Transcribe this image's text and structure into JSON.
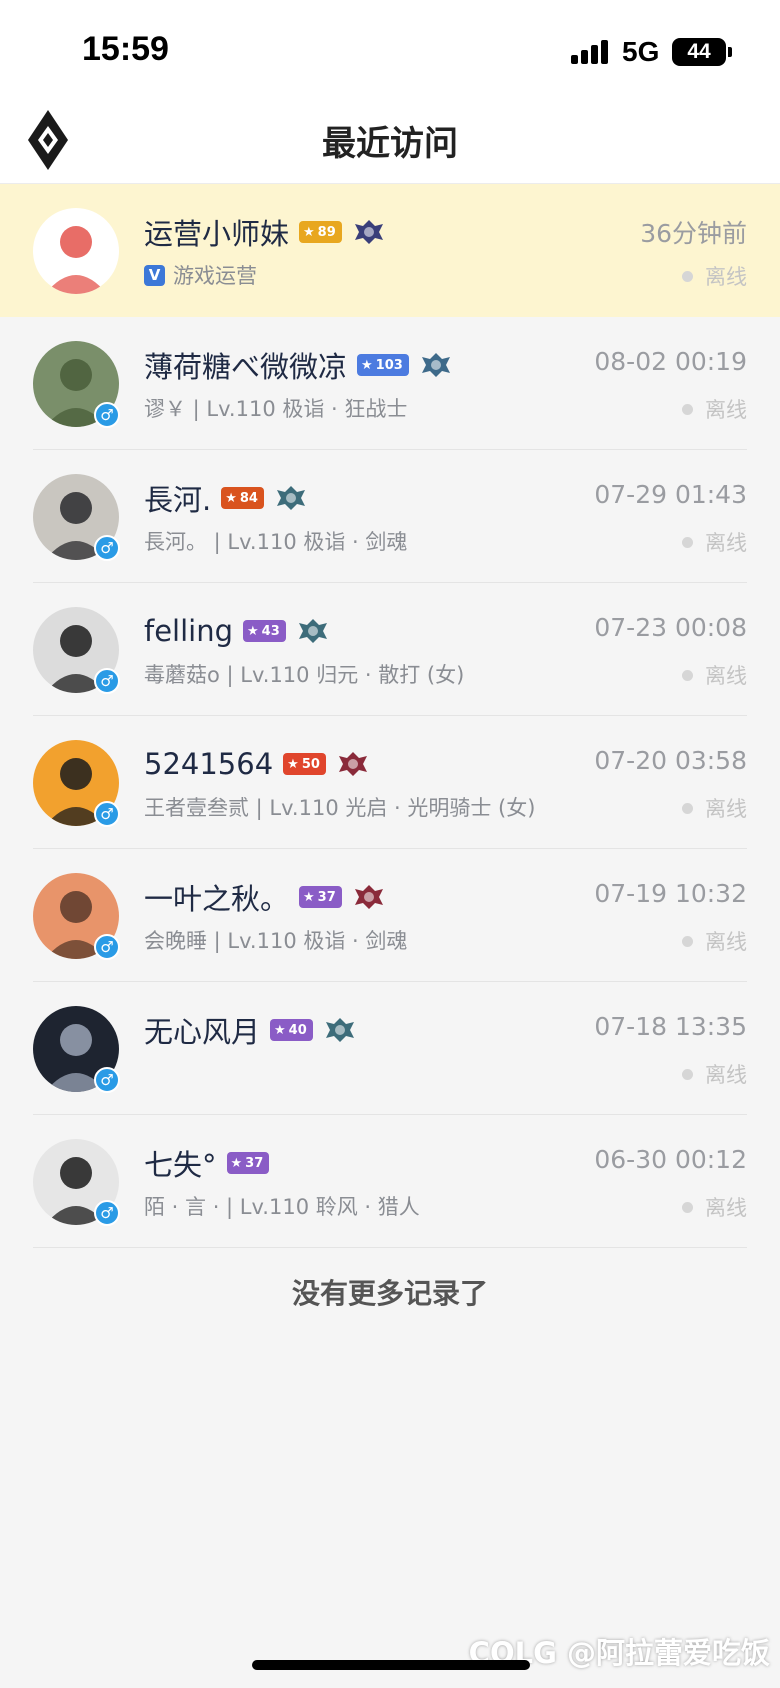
{
  "status_bar": {
    "time": "15:59",
    "network": "5G",
    "battery": "44"
  },
  "nav": {
    "title": "最近访问",
    "back_icon": "diamond-back-icon"
  },
  "visits": [
    {
      "name": "运营小师妹",
      "level": "89",
      "level_color": "#e8a71f",
      "emblem_color": "#3a3f7a",
      "sub": "游戏运营",
      "verified": true,
      "time": "36分钟前",
      "status": "离线",
      "highlight": true,
      "gender": false,
      "avatar_bg": "#ffffff",
      "avatar_fg": "#e4544c"
    },
    {
      "name": "薄荷糖べ微微凉",
      "level": "103",
      "level_color": "#4c7be0",
      "emblem_color": "#3e6a8a",
      "sub": "谬￥ | Lv.110 极诣 · 狂战士",
      "verified": false,
      "time": "08-02 00:19",
      "status": "离线",
      "highlight": false,
      "gender": true,
      "avatar_bg": "#7a8f6a",
      "avatar_fg": "#4a5e3a"
    },
    {
      "name": "長河.",
      "level": "84",
      "level_color": "#d9531e",
      "emblem_color": "#3d6c7a",
      "sub": "長河。 | Lv.110 极诣 · 剑魂",
      "verified": false,
      "time": "07-29 01:43",
      "status": "离线",
      "highlight": false,
      "gender": true,
      "avatar_bg": "#c9c6c0",
      "avatar_fg": "#2a2a2e"
    },
    {
      "name": "felling",
      "level": "43",
      "level_color": "#8a5cc6",
      "emblem_color": "#3d6c7a",
      "sub": "毒蘑菇o | Lv.110 归元 · 散打 (女)",
      "verified": false,
      "time": "07-23 00:08",
      "status": "离线",
      "highlight": false,
      "gender": true,
      "avatar_bg": "#dcdcdc",
      "avatar_fg": "#1c1c1c"
    },
    {
      "name": "5241564",
      "level": "50",
      "level_color": "#e0452c",
      "emblem_color": "#8a2a3a",
      "sub": "王者壹叁贰 | Lv.110 光启 · 光明骑士 (女)",
      "verified": false,
      "time": "07-20 03:58",
      "status": "离线",
      "highlight": false,
      "gender": true,
      "avatar_bg": "#f2a12e",
      "avatar_fg": "#1c1c1c"
    },
    {
      "name": "一叶之秋。",
      "level": "37",
      "level_color": "#8a5cc6",
      "emblem_color": "#8a2a3a",
      "sub": "会晚睡 | Lv.110 极诣 · 剑魂",
      "verified": false,
      "time": "07-19 10:32",
      "status": "离线",
      "highlight": false,
      "gender": true,
      "avatar_bg": "#e8946a",
      "avatar_fg": "#5a3a2a"
    },
    {
      "name": "无心风月",
      "level": "40",
      "level_color": "#8a5cc6",
      "emblem_color": "#3d6c7a",
      "sub": "",
      "verified": false,
      "time": "07-18 13:35",
      "status": "离线",
      "highlight": false,
      "gender": true,
      "avatar_bg": "#1e2430",
      "avatar_fg": "#9aa3b5"
    },
    {
      "name": "七失°",
      "level": "37",
      "level_color": "#8a5cc6",
      "emblem_color": "",
      "sub": "陌 · 言 · | Lv.110 聆风 · 猎人",
      "verified": false,
      "time": "06-30 00:12",
      "status": "离线",
      "highlight": false,
      "gender": true,
      "avatar_bg": "#e6e6e6",
      "avatar_fg": "#1a1a1a"
    }
  ],
  "footer": {
    "end_text": "没有更多记录了"
  },
  "watermark": "COLG @阿拉蕾爱吃饭"
}
